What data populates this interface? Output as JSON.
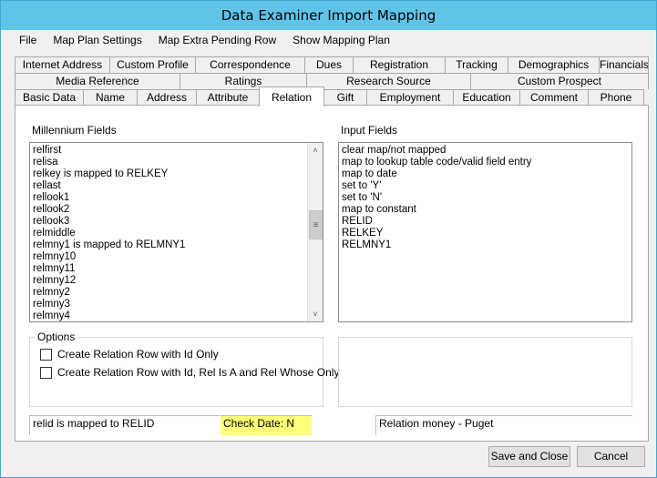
{
  "window": {
    "title": "Data Examiner Import Mapping"
  },
  "menu": [
    "File",
    "Map Plan Settings",
    "Map Extra Pending Row",
    "Show Mapping Plan"
  ],
  "tabs": {
    "row1": [
      "Internet Address",
      "Custom Profile",
      "Correspondence",
      "Dues",
      "Registration",
      "Tracking",
      "Demographics",
      "Financials"
    ],
    "row2": [
      "Media Reference",
      "Ratings",
      "Research Source",
      "Custom Prospect"
    ],
    "row3": [
      "Basic Data",
      "Name",
      "Address",
      "Attribute",
      "Relation",
      "Gift",
      "Employment",
      "Education",
      "Comment",
      "Phone"
    ],
    "active": "Relation"
  },
  "millennium_fields": {
    "label": "Millennium Fields",
    "items": [
      "relfirst",
      "relisa",
      "relkey is mapped to RELKEY",
      "rellast",
      "rellook1",
      "rellook2",
      "rellook3",
      "relmiddle",
      "relmny1 is mapped to RELMNY1",
      "relmny10",
      "relmny11",
      "relmny12",
      "relmny2",
      "relmny3",
      "relmny4"
    ]
  },
  "input_fields": {
    "label": "Input Fields",
    "items": [
      "clear map/not mapped",
      "map to lookup table code/valid field entry",
      "map to date",
      "set to 'Y'",
      "set to 'N'",
      "map to constant",
      "RELID",
      "RELKEY",
      "RELMNY1"
    ]
  },
  "options": {
    "label": "Options",
    "checkboxes": [
      "Create Relation Row with Id Only",
      "Create Relation Row with Id, Rel Is A and Rel Whose Only"
    ]
  },
  "status": {
    "left": "relid is mapped to RELID",
    "middle": "Check Date: N",
    "right": "Relation money - Puget"
  },
  "buttons": {
    "save_close": "Save and Close",
    "cancel": "Cancel"
  }
}
